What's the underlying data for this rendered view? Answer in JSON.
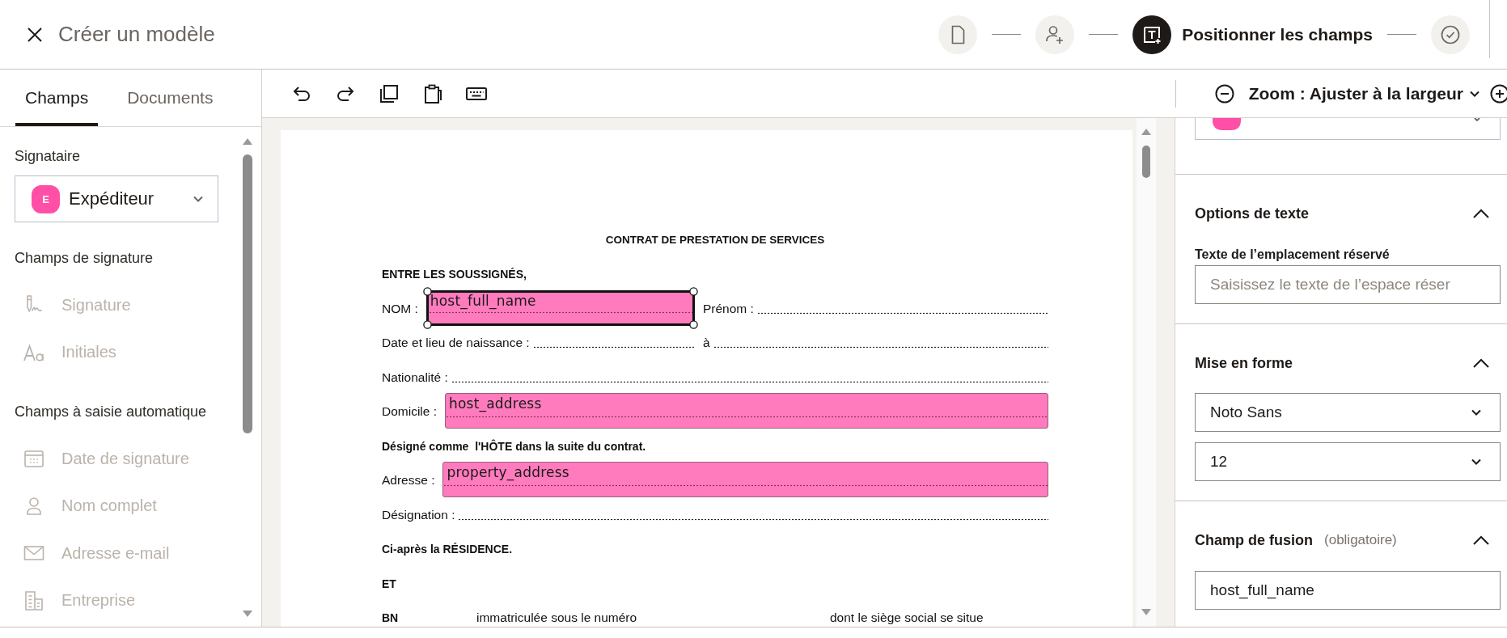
{
  "header": {
    "title": "Créer un modèle",
    "steps": [
      {
        "kind": "document",
        "selected": false
      },
      {
        "kind": "signers",
        "selected": false
      },
      {
        "kind": "fields",
        "selected": true,
        "label": "Positionner les champs"
      },
      {
        "kind": "review",
        "selected": false
      }
    ]
  },
  "sidebar": {
    "tabs": [
      {
        "label": "Champs",
        "selected": true
      },
      {
        "label": "Documents",
        "selected": false
      }
    ],
    "signer": {
      "label": "Signataire",
      "badge": "E",
      "value": "Expéditeur"
    },
    "groups": [
      {
        "title": "Champs de signature",
        "items": [
          {
            "kind": "signature",
            "label": "Signature",
            "disabled": true
          },
          {
            "kind": "initials",
            "label": "Initiales",
            "disabled": true
          }
        ]
      },
      {
        "title": "Champs à saisie automatique",
        "items": [
          {
            "kind": "date",
            "label": "Date de signature",
            "disabled": true
          },
          {
            "kind": "name",
            "label": "Nom complet",
            "disabled": true
          },
          {
            "kind": "email",
            "label": "Adresse e-mail",
            "disabled": true
          },
          {
            "kind": "company",
            "label": "Entreprise",
            "disabled": true
          }
        ]
      }
    ]
  },
  "toolbar": {
    "zoom": "Zoom : Ajuster à la largeur"
  },
  "document": {
    "title": "CONTRAT DE PRESTATION DE SERVICES",
    "lines": [
      {
        "kind": "bold",
        "text": "ENTRE LES SOUSSIGNÉS,"
      },
      {
        "kind": "blanks",
        "parts": [
          {
            "label": "NOM :",
            "field": {
              "name": "host_full_name",
              "selected": true
            }
          },
          {
            "label": "Prénom :"
          }
        ]
      },
      {
        "kind": "blanks",
        "parts": [
          {
            "label": "Date et lieu de naissance :"
          },
          {
            "label": "à"
          }
        ]
      },
      {
        "kind": "blanks",
        "parts": [
          {
            "label": "Nationalité :"
          }
        ]
      },
      {
        "kind": "blanks",
        "parts": [
          {
            "label": "Domicile :",
            "field": {
              "name": "host_address",
              "selected": false
            }
          }
        ]
      },
      {
        "kind": "bold",
        "text": "Désigné comme  l'HÔTE dans la suite du contrat."
      },
      {
        "kind": "blanks",
        "parts": [
          {
            "label": "Adresse :",
            "field": {
              "name": "property_address",
              "selected": false
            }
          }
        ]
      },
      {
        "kind": "blanks",
        "parts": [
          {
            "label": "Désignation :"
          }
        ]
      },
      {
        "kind": "bold",
        "text": "Ci-après la RÉSIDENCE."
      },
      {
        "kind": "bold",
        "text": "ET"
      },
      {
        "kind": "fragments",
        "parts": [
          {
            "text": "BN",
            "bold": true
          },
          {
            "text": "immatriculée sous le numéro",
            "bold": false
          },
          {
            "text": "dont le siège social se situe",
            "bold": false
          }
        ]
      }
    ]
  },
  "properties": {
    "sections": [
      {
        "kind": "text",
        "title": "Options de texte",
        "expanded": true,
        "label": "Texte de l’emplacement réservé",
        "placeholder": "Saisissez le texte de l’espace réser"
      },
      {
        "kind": "format",
        "title": "Mise en forme",
        "expanded": true,
        "font": "Noto Sans",
        "size": "12"
      },
      {
        "kind": "merge",
        "title": "Champ de fusion",
        "note": "(obligatoire)",
        "expanded": true,
        "value": "host_full_name"
      }
    ]
  }
}
